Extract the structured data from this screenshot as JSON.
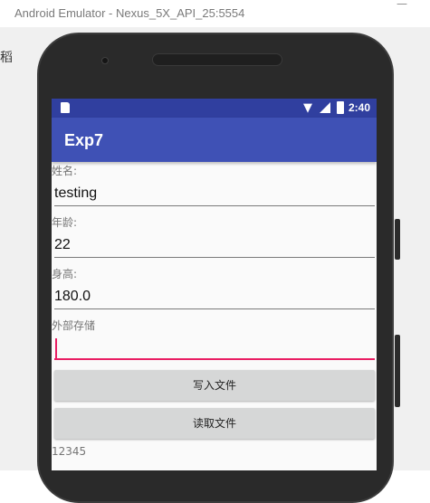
{
  "window": {
    "title": "Android Emulator - Nexus_5X_API_25:5554",
    "minimize": "—"
  },
  "host": {
    "partial_glyph": "稻"
  },
  "statusbar": {
    "time": "2:40",
    "wifi_icon": "wifi-icon",
    "signal_icon": "signal-icon",
    "battery_icon": "battery-icon",
    "sd_icon": "sd-card-icon",
    "color": "#303f9f"
  },
  "appbar": {
    "title": "Exp7",
    "color": "#3f51b5"
  },
  "form": {
    "name_label": "姓名:",
    "name_value": "testing",
    "age_label": "年龄:",
    "age_value": "22",
    "height_label": "身高:",
    "height_value": "180.0",
    "storage_label": "外部存储",
    "storage_value": ""
  },
  "buttons": {
    "write": "写入文件",
    "read": "读取文件"
  },
  "output_text": "12345",
  "accent_color": "#e91e63"
}
